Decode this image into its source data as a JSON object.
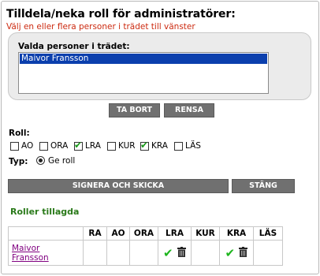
{
  "header": {
    "title": "Tilldela/neka roll för administratörer:",
    "subtitle": "Välj en eller flera personer i trädet till vänster"
  },
  "selection": {
    "label": "Valda personer i trädet:",
    "items": [
      "Maivor Fransson"
    ]
  },
  "selection_buttons": {
    "remove": "TA BORT",
    "clear": "RENSA"
  },
  "roles": {
    "label": "Roll:",
    "options": [
      {
        "code": "AO",
        "checked": false
      },
      {
        "code": "ORA",
        "checked": false
      },
      {
        "code": "LRA",
        "checked": true
      },
      {
        "code": "KUR",
        "checked": false
      },
      {
        "code": "KRA",
        "checked": true
      },
      {
        "code": "LÄS",
        "checked": false
      }
    ]
  },
  "type": {
    "label": "Typ:",
    "option_label": "Ge roll",
    "selected": true
  },
  "actions": {
    "sign": "SIGNERA OCH SKICKA",
    "close": "STÄNG"
  },
  "added": {
    "title": "Roller tillagda",
    "columns": [
      "",
      "RA",
      "AO",
      "ORA",
      "LRA",
      "KUR",
      "KRA",
      "LÄS"
    ],
    "rows": [
      {
        "name_line1": "Maivor",
        "name_line2": "Fransson",
        "marks": [
          "",
          "",
          "",
          "check+trash",
          "",
          "check+trash",
          ""
        ]
      }
    ]
  },
  "colors": {
    "accent_red": "#cc2a10",
    "selection_blue": "#0b3fad",
    "added_green": "#2a7a1a",
    "button_gray": "#707070",
    "check_green": "#1db51d"
  }
}
